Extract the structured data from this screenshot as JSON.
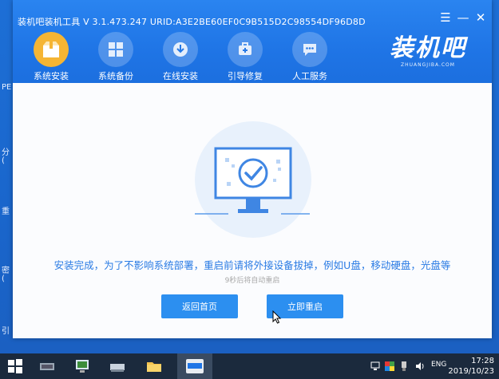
{
  "desktop": {
    "labels": [
      "PE",
      "分",
      "(",
      "重",
      "密",
      "(",
      "引"
    ]
  },
  "window": {
    "title": "装机吧装机工具 V 3.1.473.247 URID:A3E2BE60EF0C9B515D2C98554DF96D8D",
    "controls": {
      "menu": "☰",
      "minimize": "—",
      "close": "✕"
    }
  },
  "nav": {
    "items": [
      {
        "label": "系统安装",
        "icon": "package-icon",
        "active": true
      },
      {
        "label": "系统备份",
        "icon": "windows-icon",
        "active": false
      },
      {
        "label": "在线安装",
        "icon": "download-icon",
        "active": false
      },
      {
        "label": "引导修复",
        "icon": "repair-icon",
        "active": false
      },
      {
        "label": "人工服务",
        "icon": "chat-icon",
        "active": false
      }
    ]
  },
  "brand": {
    "main": "装机吧",
    "sub": "ZHUANGJIBA.COM"
  },
  "main": {
    "message": "安装完成，为了不影响系统部署，重启前请将外接设备拔掉，例如U盘，移动硬盘，光盘等",
    "countdown": "9秒后将自动重启",
    "buttons": {
      "home": "返回首页",
      "restart": "立即重启"
    }
  },
  "taskbar": {
    "apps": [
      "start-icon",
      "disk-tool-icon",
      "network-icon",
      "drive-icon",
      "folder-icon",
      "zhuangjiba-app-icon"
    ],
    "tray_lang": "ENG",
    "time": "17:28",
    "date": "2019/10/23"
  },
  "colors": {
    "accent": "#2c8ff0",
    "message": "#2a7be4",
    "active_nav": "#f5b534",
    "header": "#1f75e6"
  }
}
